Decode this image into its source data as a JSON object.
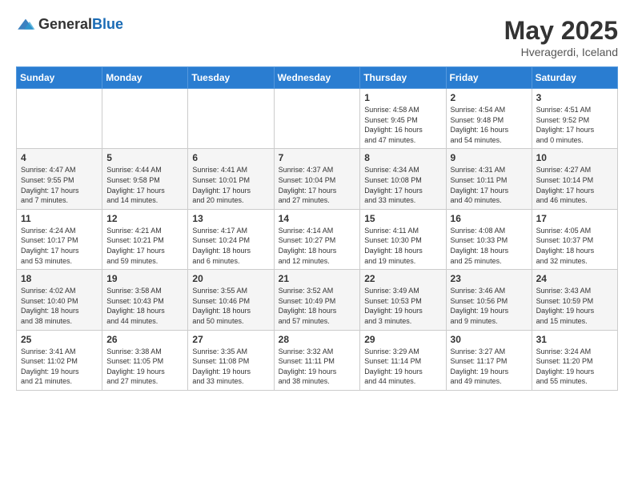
{
  "header": {
    "logo_general": "General",
    "logo_blue": "Blue",
    "title": "May 2025",
    "subtitle": "Hveragerdi, Iceland"
  },
  "days_of_week": [
    "Sunday",
    "Monday",
    "Tuesday",
    "Wednesday",
    "Thursday",
    "Friday",
    "Saturday"
  ],
  "weeks": [
    [
      {
        "day": "",
        "info": ""
      },
      {
        "day": "",
        "info": ""
      },
      {
        "day": "",
        "info": ""
      },
      {
        "day": "",
        "info": ""
      },
      {
        "day": "1",
        "info": "Sunrise: 4:58 AM\nSunset: 9:45 PM\nDaylight: 16 hours\nand 47 minutes."
      },
      {
        "day": "2",
        "info": "Sunrise: 4:54 AM\nSunset: 9:48 PM\nDaylight: 16 hours\nand 54 minutes."
      },
      {
        "day": "3",
        "info": "Sunrise: 4:51 AM\nSunset: 9:52 PM\nDaylight: 17 hours\nand 0 minutes."
      }
    ],
    [
      {
        "day": "4",
        "info": "Sunrise: 4:47 AM\nSunset: 9:55 PM\nDaylight: 17 hours\nand 7 minutes."
      },
      {
        "day": "5",
        "info": "Sunrise: 4:44 AM\nSunset: 9:58 PM\nDaylight: 17 hours\nand 14 minutes."
      },
      {
        "day": "6",
        "info": "Sunrise: 4:41 AM\nSunset: 10:01 PM\nDaylight: 17 hours\nand 20 minutes."
      },
      {
        "day": "7",
        "info": "Sunrise: 4:37 AM\nSunset: 10:04 PM\nDaylight: 17 hours\nand 27 minutes."
      },
      {
        "day": "8",
        "info": "Sunrise: 4:34 AM\nSunset: 10:08 PM\nDaylight: 17 hours\nand 33 minutes."
      },
      {
        "day": "9",
        "info": "Sunrise: 4:31 AM\nSunset: 10:11 PM\nDaylight: 17 hours\nand 40 minutes."
      },
      {
        "day": "10",
        "info": "Sunrise: 4:27 AM\nSunset: 10:14 PM\nDaylight: 17 hours\nand 46 minutes."
      }
    ],
    [
      {
        "day": "11",
        "info": "Sunrise: 4:24 AM\nSunset: 10:17 PM\nDaylight: 17 hours\nand 53 minutes."
      },
      {
        "day": "12",
        "info": "Sunrise: 4:21 AM\nSunset: 10:21 PM\nDaylight: 17 hours\nand 59 minutes."
      },
      {
        "day": "13",
        "info": "Sunrise: 4:17 AM\nSunset: 10:24 PM\nDaylight: 18 hours\nand 6 minutes."
      },
      {
        "day": "14",
        "info": "Sunrise: 4:14 AM\nSunset: 10:27 PM\nDaylight: 18 hours\nand 12 minutes."
      },
      {
        "day": "15",
        "info": "Sunrise: 4:11 AM\nSunset: 10:30 PM\nDaylight: 18 hours\nand 19 minutes."
      },
      {
        "day": "16",
        "info": "Sunrise: 4:08 AM\nSunset: 10:33 PM\nDaylight: 18 hours\nand 25 minutes."
      },
      {
        "day": "17",
        "info": "Sunrise: 4:05 AM\nSunset: 10:37 PM\nDaylight: 18 hours\nand 32 minutes."
      }
    ],
    [
      {
        "day": "18",
        "info": "Sunrise: 4:02 AM\nSunset: 10:40 PM\nDaylight: 18 hours\nand 38 minutes."
      },
      {
        "day": "19",
        "info": "Sunrise: 3:58 AM\nSunset: 10:43 PM\nDaylight: 18 hours\nand 44 minutes."
      },
      {
        "day": "20",
        "info": "Sunrise: 3:55 AM\nSunset: 10:46 PM\nDaylight: 18 hours\nand 50 minutes."
      },
      {
        "day": "21",
        "info": "Sunrise: 3:52 AM\nSunset: 10:49 PM\nDaylight: 18 hours\nand 57 minutes."
      },
      {
        "day": "22",
        "info": "Sunrise: 3:49 AM\nSunset: 10:53 PM\nDaylight: 19 hours\nand 3 minutes."
      },
      {
        "day": "23",
        "info": "Sunrise: 3:46 AM\nSunset: 10:56 PM\nDaylight: 19 hours\nand 9 minutes."
      },
      {
        "day": "24",
        "info": "Sunrise: 3:43 AM\nSunset: 10:59 PM\nDaylight: 19 hours\nand 15 minutes."
      }
    ],
    [
      {
        "day": "25",
        "info": "Sunrise: 3:41 AM\nSunset: 11:02 PM\nDaylight: 19 hours\nand 21 minutes."
      },
      {
        "day": "26",
        "info": "Sunrise: 3:38 AM\nSunset: 11:05 PM\nDaylight: 19 hours\nand 27 minutes."
      },
      {
        "day": "27",
        "info": "Sunrise: 3:35 AM\nSunset: 11:08 PM\nDaylight: 19 hours\nand 33 minutes."
      },
      {
        "day": "28",
        "info": "Sunrise: 3:32 AM\nSunset: 11:11 PM\nDaylight: 19 hours\nand 38 minutes."
      },
      {
        "day": "29",
        "info": "Sunrise: 3:29 AM\nSunset: 11:14 PM\nDaylight: 19 hours\nand 44 minutes."
      },
      {
        "day": "30",
        "info": "Sunrise: 3:27 AM\nSunset: 11:17 PM\nDaylight: 19 hours\nand 49 minutes."
      },
      {
        "day": "31",
        "info": "Sunrise: 3:24 AM\nSunset: 11:20 PM\nDaylight: 19 hours\nand 55 minutes."
      }
    ]
  ]
}
